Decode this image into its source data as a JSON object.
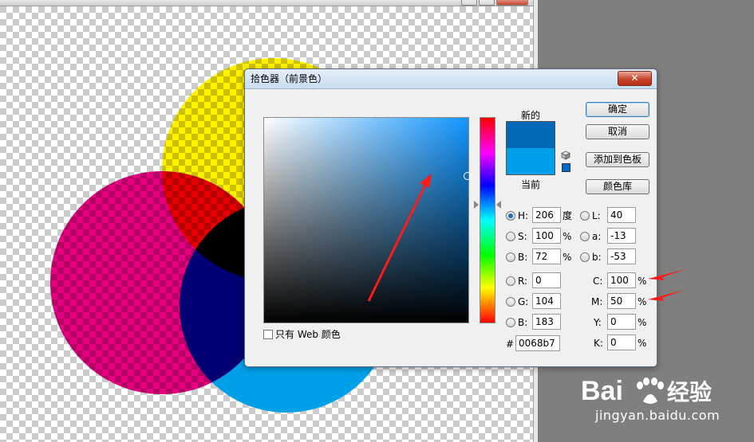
{
  "dialog": {
    "title": "拾色器（前景色）",
    "close_glyph": "✕",
    "buttons": {
      "ok": "确定",
      "cancel": "取消",
      "add_to_swatches": "添加到色板",
      "color_libraries": "颜色库"
    },
    "preview": {
      "new_label": "新的",
      "current_label": "当前",
      "new_color": "#0068b7",
      "current_color": "#00a0e9"
    },
    "hsb": [
      {
        "label": "H:",
        "value": "206",
        "unit": "度",
        "checked": true
      },
      {
        "label": "S:",
        "value": "100",
        "unit": "%",
        "checked": false
      },
      {
        "label": "B:",
        "value": "72",
        "unit": "%",
        "checked": false
      }
    ],
    "rgb": [
      {
        "label": "R:",
        "value": "0"
      },
      {
        "label": "G:",
        "value": "104"
      },
      {
        "label": "B:",
        "value": "183"
      }
    ],
    "lab": [
      {
        "label": "L:",
        "value": "40"
      },
      {
        "label": "a:",
        "value": "-13"
      },
      {
        "label": "b:",
        "value": "-53"
      }
    ],
    "cmyk": [
      {
        "label": "C:",
        "value": "100",
        "unit": "%"
      },
      {
        "label": "M:",
        "value": "50",
        "unit": "%"
      },
      {
        "label": "Y:",
        "value": "0",
        "unit": "%"
      },
      {
        "label": "K:",
        "value": "0",
        "unit": "%"
      }
    ],
    "hex_label": "#",
    "hex_value": "0068b7",
    "web_only_label": "只有 Web 颜色",
    "icons": [
      "close-icon",
      "out-of-gamut-cube-icon",
      "hue-slider-arrow-icon",
      "annotation-arrow-icon"
    ]
  },
  "canvas": {
    "circle_colors": {
      "cyan": "#00a0e9",
      "magenta": "#e4007f",
      "yellow": "#fff100"
    }
  },
  "watermark": {
    "brand": "Bai",
    "brand_suffix": "经验",
    "url": "jingyan.baidu.com"
  }
}
